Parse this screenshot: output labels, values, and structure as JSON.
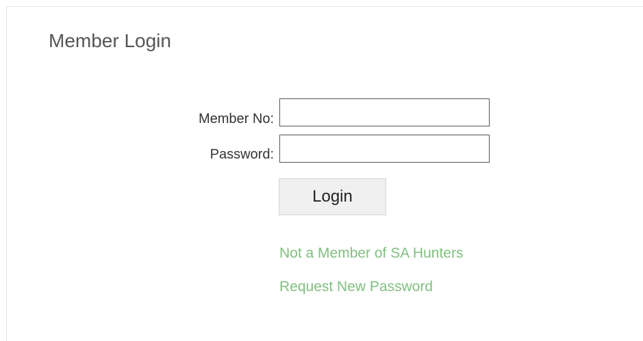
{
  "login": {
    "title": "Member Login",
    "member_no_label": "Member No:",
    "member_no_value": "",
    "password_label": "Password:",
    "password_value": "",
    "login_button_label": "Login"
  },
  "links": {
    "not_member": "Not a Member of SA Hunters",
    "request_password": "Request New Password"
  },
  "colors": {
    "link": "#80bf80",
    "title": "#555555",
    "button_bg": "#f0f0f0"
  }
}
